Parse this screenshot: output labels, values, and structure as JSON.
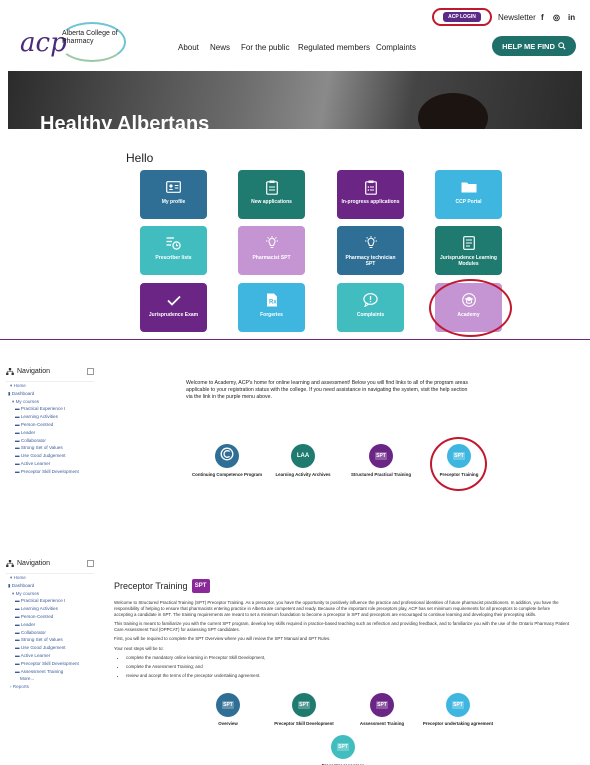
{
  "header": {
    "login_label": "ACP LOGIN",
    "newsletter": "Newsletter",
    "social": [
      "f",
      "◎",
      "in"
    ],
    "logo_mark": "acp",
    "logo_text": "Alberta College of Pharmacy",
    "nav": [
      "About",
      "News",
      "For the public",
      "Regulated members",
      "Complaints"
    ],
    "help_button": "HELP ME FIND",
    "hero_title": "Healthy Albertans"
  },
  "dashboard": {
    "greeting": "Hello",
    "tiles": [
      {
        "label": "My profile",
        "color": "#2f6f95",
        "icon": "id-card-icon"
      },
      {
        "label": "New applications",
        "color": "#1f7a70",
        "icon": "clipboard-icon"
      },
      {
        "label": "In-progress applications",
        "color": "#6a2585",
        "icon": "clipboard-list-icon"
      },
      {
        "label": "CCP Portal",
        "color": "#3fb6e0",
        "icon": "folder-icon"
      },
      {
        "label": "Prescriber lists",
        "color": "#41bdc0",
        "icon": "list-clock-icon"
      },
      {
        "label": "Pharmacist SPT",
        "color": "#c594d3",
        "icon": "lightbulb-icon"
      },
      {
        "label": "Pharmacy technician SPT",
        "color": "#2f6f95",
        "icon": "lightbulb-icon"
      },
      {
        "label": "Jurisprudence Learning Modules",
        "color": "#1f7a70",
        "icon": "document-icon"
      },
      {
        "label": "Jurisprudence Exam",
        "color": "#6a2585",
        "icon": "checkmark-icon"
      },
      {
        "label": "Forgeries",
        "color": "#3fb6e0",
        "icon": "prescription-icon"
      },
      {
        "label": "Complaints",
        "color": "#41bdc0",
        "icon": "speech-alert-icon"
      },
      {
        "label": "Academy",
        "color": "#c594d3",
        "icon": "academy-icon"
      }
    ]
  },
  "academy": {
    "nav_title": "Navigation",
    "nav_items": [
      "Home",
      "Dashboard",
      "My courses",
      "Practical Experience I",
      "Learning Activities",
      "Person-Centred",
      "Leader",
      "Collaborator",
      "Strong Set of Values",
      "Use Good Judgement",
      "Active Learner",
      "Preceptor Skill Development"
    ],
    "welcome": "Welcome to Academy, ACP's home for online learning and assessment! Below you will find links to all of the program areas applicable to your registration status with the college. If you need assistance in navigating the system, visit the help section via the link in the purple menu above.",
    "courses": [
      {
        "label": "Continuing Competence Program",
        "color": "#2f6f95",
        "icon": "cc-icon"
      },
      {
        "label": "Learning Activity Archives",
        "color": "#1f7a70",
        "icon": "laa-icon",
        "text": "LAA"
      },
      {
        "label": "Structured Practical Training",
        "color": "#6a2585",
        "icon": "spt-icon",
        "text": "SPT"
      },
      {
        "label": "Preceptor Training",
        "color": "#3fb6e0",
        "icon": "spt-icon",
        "text": "SPT"
      }
    ]
  },
  "preceptor": {
    "nav_title": "Navigation",
    "nav_items": [
      "Home",
      "Dashboard",
      "My courses",
      "Practical Experience I",
      "Learning Activities",
      "Person-Centred",
      "Leader",
      "Collaborator",
      "Strong Set of Values",
      "Use Good Judgement",
      "Active Learner",
      "Preceptor Skill Development",
      "Assessment Training",
      "More...",
      "Reports"
    ],
    "title": "Preceptor Training",
    "badge": "SPT",
    "p1": "Welcome to Structured Practical Training (SPT) Preceptor Training. As a preceptor, you have the opportunity to positively influence the practice and professional identities of future pharmacist practitioners. In addition, you have the responsibility of helping to ensure that pharmacists entering practice in Alberta are competent and ready. Because of the important role preceptors play, ACP has set minimum requirements for all preceptors to complete before accepting a candidate in SPT. The training requirements are meant to set a minimum foundation to become a preceptor in SPT and preceptors are encouraged to continue learning and developing their precepting skills.",
    "p2": "This training is meant to familiarize you with the current SPT program, develop key skills required in practice-based teaching such as reflection and providing feedback, and to familiarize you with the use of the Ontario Pharmacy Patient Care Assessment Tool (OPPCAT) for assessing SPT candidates.",
    "p3": "First, you will be required to complete the SPT Overview where you will review the SPT Manual and SPT Rules.",
    "p4": "Your next steps will be to:",
    "steps": [
      "complete the mandatory online learning in Preceptor Skill Development,",
      "complete the Assessment Training; and",
      "review and accept the terms of the preceptor undertaking agreement."
    ],
    "modules": [
      {
        "label": "Overview",
        "color": "#2f6f95"
      },
      {
        "label": "Preceptor Skill Development",
        "color": "#1f7a70"
      },
      {
        "label": "Assessment Training",
        "color": "#6a2585"
      },
      {
        "label": "Preceptor undertaking agreement",
        "color": "#3fb6e0"
      },
      {
        "label": "Preceptor resources",
        "color": "#41bdc0"
      }
    ]
  }
}
